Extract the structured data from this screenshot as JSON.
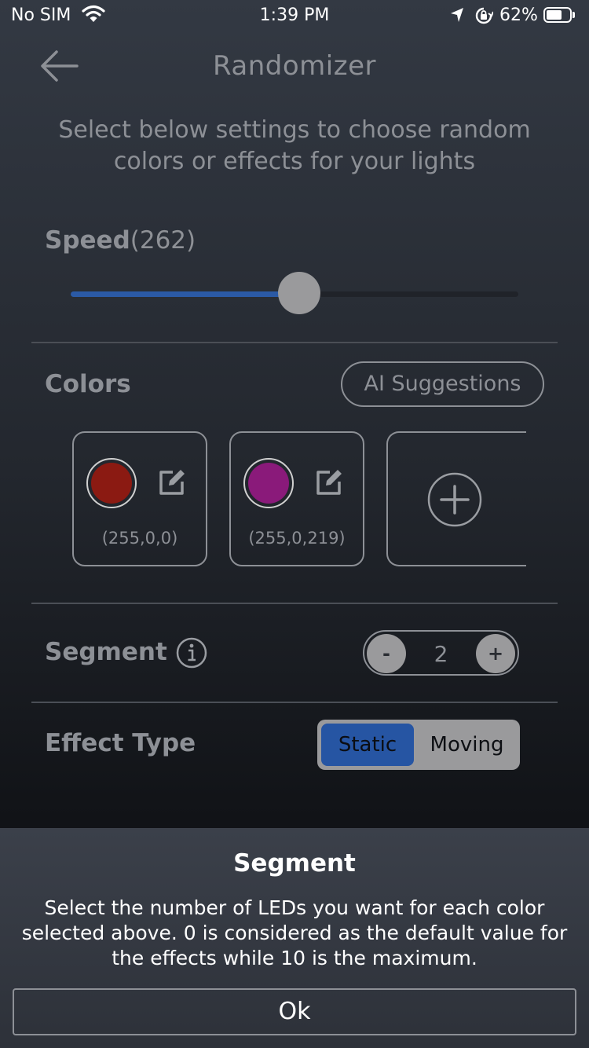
{
  "status_bar": {
    "carrier": "No SIM",
    "time": "1:39 PM",
    "battery_percent": "62%",
    "battery_level": 0.62,
    "icons": [
      "wifi-icon",
      "location-arrow-icon",
      "rotation-lock-icon",
      "battery-icon"
    ]
  },
  "header": {
    "title": "Randomizer",
    "back_icon": "arrow-left-icon"
  },
  "subtitle": "Select below settings to choose random colors or effects for your lights",
  "speed": {
    "label": "Speed",
    "value_text": "(262)",
    "value": 262,
    "fraction": 0.51,
    "fill_color": "#2b5aa6"
  },
  "colors": {
    "label": "Colors",
    "ai_button": "AI Suggestions",
    "items": [
      {
        "rgb": "(255,0,0)",
        "swatch": "#8b1a12"
      },
      {
        "rgb": "(255,0,219)",
        "swatch": "#8a1a7a"
      }
    ],
    "add_icon": "plus-circle-icon",
    "edit_icon": "edit-icon"
  },
  "segment": {
    "label": "Segment",
    "info_icon": "info-icon",
    "minus": "-",
    "plus": "+",
    "value": "2"
  },
  "effect_type": {
    "label": "Effect Type",
    "options": [
      "Static",
      "Moving"
    ],
    "selected": "Static",
    "selected_color": "#2655a3"
  },
  "sheet": {
    "title": "Segment",
    "body": "Select the number of LEDs you want for each color selected above. 0 is considered as the default value for the effects while 10 is the maximum.",
    "ok": "Ok"
  }
}
